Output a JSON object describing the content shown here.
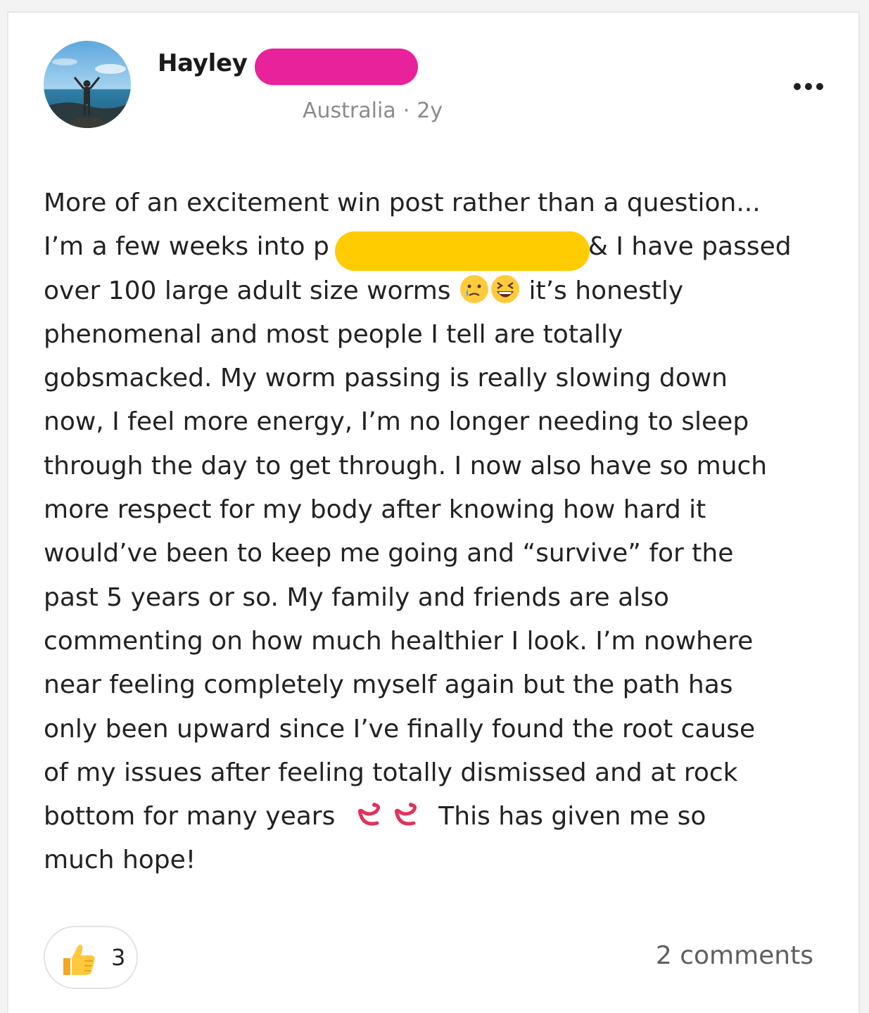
{
  "post": {
    "author_name": "Hayley",
    "location": "Australia",
    "separator": "·",
    "age": "2y",
    "more_label": "...",
    "lines": [
      {
        "text": "More of an excitement win post rather than a question..."
      },
      {
        "text_before": "I’m a few weeks into p",
        "text_after": "& I have passed"
      },
      {
        "text_before": "over 100 large adult size worms",
        "text_after": "it’s honestly"
      },
      {
        "text": "phenomenal and most people I tell are totally"
      },
      {
        "text": "gobsmacked. My worm passing is really slowing down"
      },
      {
        "text": "now, I feel more energy, I’m no longer needing to sleep"
      },
      {
        "text": "through the day to get through. I now also have so much"
      },
      {
        "text": "more respect for my body after knowing how hard it"
      },
      {
        "text": "would’ve been to keep me going and “survive” for the"
      },
      {
        "text": "past 5 years or so. My family and friends are also"
      },
      {
        "text": "commenting on how much healthier I look. I’m nowhere"
      },
      {
        "text": "near feeling completely myself again but the path has"
      },
      {
        "text": "only been upward since I’ve finally found the root cause"
      },
      {
        "text": "of my issues after feeling totally dismissed and at rock"
      },
      {
        "text_before": "bottom for many years",
        "text_after": "This has given me so"
      },
      {
        "text": "much hope!"
      }
    ],
    "emojis": [
      "crying-face-icon",
      "laughing-face-icon",
      "worm-icon",
      "worm-icon"
    ],
    "like_count": "3",
    "comments_label": "2 comments"
  },
  "colors": {
    "redaction_pink": "#e8229a",
    "redaction_yellow": "#ffcc00",
    "meta_gray": "#8b8b8b"
  }
}
